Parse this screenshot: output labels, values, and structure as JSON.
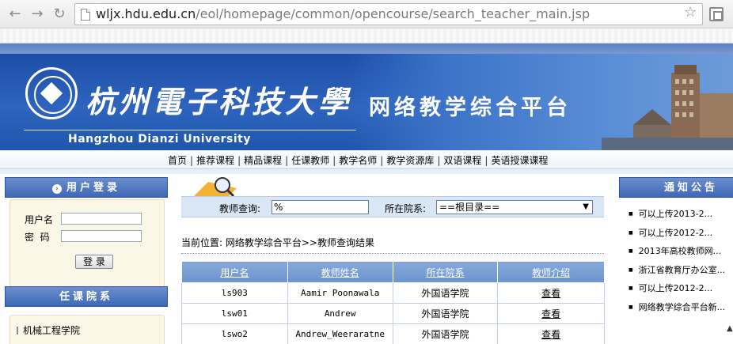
{
  "browser": {
    "url_host": "wljx.hdu.edu.cn",
    "url_path": "/eol/homepage/common/opencourse/search_teacher_main.jsp"
  },
  "banner": {
    "cn_name": "杭州電子科技大學",
    "platform": "网络教学综合平台",
    "en_name": "Hangzhou Dianzi University"
  },
  "nav": [
    "首页",
    "推荐课程",
    "精品课程",
    "任课教师",
    "教学名师",
    "教学资源库",
    "双语课程",
    "英语授课课程"
  ],
  "login": {
    "title": "用户登录",
    "user_label": "用户名",
    "pass_label": "密  码",
    "button": "登 录"
  },
  "dept": {
    "title": "任课院系",
    "items": [
      "机械工程学院"
    ]
  },
  "search": {
    "teacher_label": "教师查询:",
    "teacher_value": "%",
    "dept_label": "所在院系:",
    "dept_value": "==根目录=="
  },
  "breadcrumb": "当前位置: 网络教学综合平台>>教师查询结果",
  "table": {
    "headers": [
      "用户名",
      "教师姓名",
      "所在院系",
      "教师介绍"
    ],
    "rows": [
      [
        "ls903",
        "Aamir Poonawala",
        "外国语学院",
        "查看"
      ],
      [
        "lsw01",
        "Andrew",
        "外国语学院",
        "查看"
      ],
      [
        "lswo2",
        "Andrew_Weeraratne",
        "外国语学院",
        "查看"
      ]
    ]
  },
  "notice": {
    "title": "通知公告",
    "items": [
      "可以上传2013-2...",
      "可以上传2012-2...",
      "2013年高校教师网...",
      "浙江省教育厅办公室...",
      "可以上传2012-2...",
      "网络教学综合平台新..."
    ]
  }
}
